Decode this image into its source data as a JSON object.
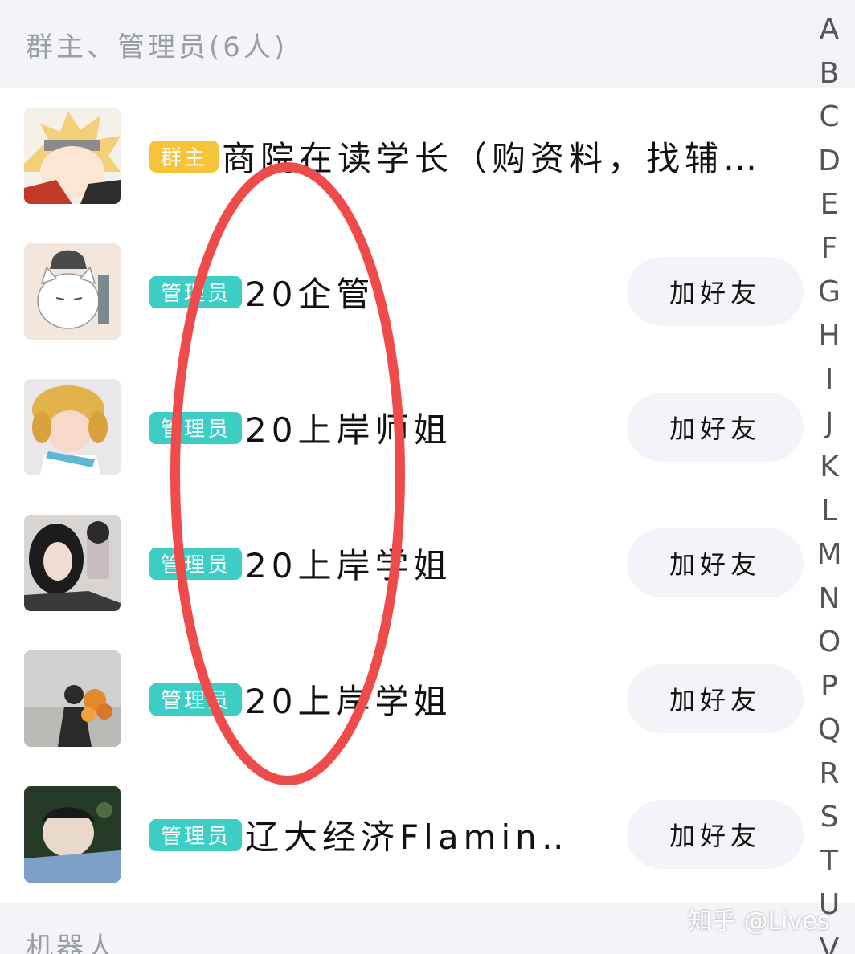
{
  "sections": {
    "admins_header": "群主、管理员(6人)",
    "robots_header": "机器人"
  },
  "members": [
    {
      "role": "群主",
      "name": "商院在读学长（购资料，找辅…",
      "avatar_icon": "anime-avatar-icon",
      "has_add_button": false
    },
    {
      "role": "管理员",
      "name": "20企管",
      "avatar_icon": "cat-avatar-icon",
      "has_add_button": true
    },
    {
      "role": "管理员",
      "name": "20上岸师姐",
      "avatar_icon": "child-hat-avatar-icon",
      "has_add_button": true
    },
    {
      "role": "管理员",
      "name": "20上岸学姐",
      "avatar_icon": "girl-selfie-avatar-icon",
      "has_add_button": true
    },
    {
      "role": "管理员",
      "name": "20上岸学姐",
      "avatar_icon": "flowers-avatar-icon",
      "has_add_button": true
    },
    {
      "role": "管理员",
      "name": "辽大经济Flamin…",
      "avatar_icon": "boy-avatar-icon",
      "has_add_button": true
    }
  ],
  "add_friend_label": "加好友",
  "alphabet_index": [
    "A",
    "B",
    "C",
    "D",
    "E",
    "F",
    "G",
    "H",
    "I",
    "J",
    "K",
    "L",
    "M",
    "N",
    "O",
    "P",
    "Q",
    "R",
    "S",
    "T",
    "U",
    "V"
  ],
  "watermark": "知乎 @Lives",
  "colors": {
    "owner_badge": "#f7c33b",
    "admin_badge": "#3ccdc5",
    "section_bg": "#f3f4f8",
    "annotation_circle": "#ef4b4b"
  }
}
